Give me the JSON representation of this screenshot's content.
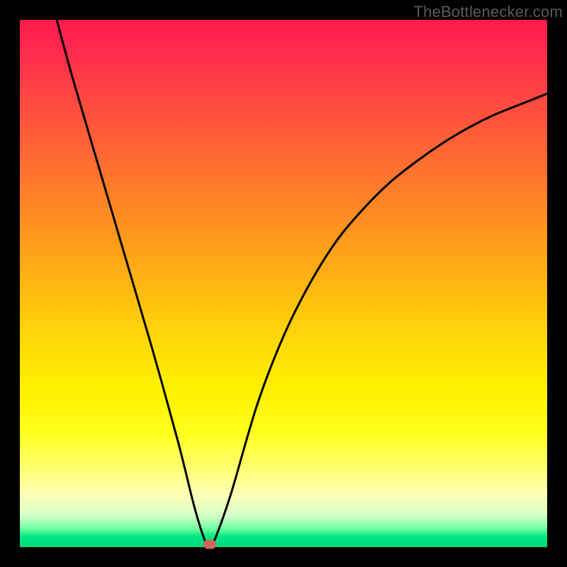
{
  "watermark": "TheBottlenecker.com",
  "chart_data": {
    "type": "line",
    "title": "",
    "xlabel": "",
    "ylabel": "",
    "xlim": [
      0,
      100
    ],
    "ylim": [
      0,
      100
    ],
    "series": [
      {
        "name": "bottleneck-curve",
        "x": [
          7,
          10,
          15,
          20,
          25,
          30,
          33,
          35,
          36,
          37,
          40,
          45,
          50,
          55,
          60,
          65,
          70,
          75,
          80,
          85,
          90,
          95,
          100
        ],
        "y": [
          100,
          89,
          72,
          55,
          38,
          20,
          8,
          1.5,
          0,
          1.5,
          10,
          27,
          40,
          50,
          58,
          64,
          69,
          73,
          76.5,
          79.5,
          82,
          84,
          86
        ]
      }
    ],
    "marker": {
      "x": 36,
      "y": 0.5
    },
    "colors": {
      "curve": "#000000",
      "marker": "#cb675d",
      "top": "#ff1a4d",
      "mid": "#ffe600",
      "bottom": "#00d878"
    }
  }
}
